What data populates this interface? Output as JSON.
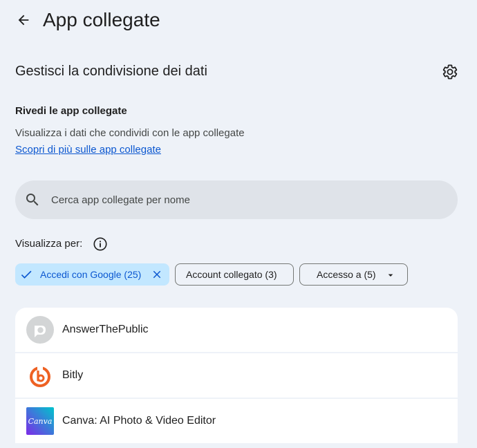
{
  "header": {
    "title": "App collegate"
  },
  "section": {
    "title": "Gestisci la condivisione dei dati"
  },
  "review": {
    "heading": "Rivedi le app collegate",
    "description": "Visualizza i dati che condividi con le app collegate",
    "learn_more": "Scopri di più sulle app collegate"
  },
  "search": {
    "placeholder": "Cerca app collegate per nome",
    "value": ""
  },
  "filters": {
    "label": "Visualizza per:",
    "chips": [
      {
        "label": "Accedi con Google (25)",
        "selected": true
      },
      {
        "label": "Account collegato (3)",
        "selected": false
      },
      {
        "label": "Accesso a (5)",
        "selected": false,
        "dropdown": true
      }
    ]
  },
  "apps": [
    {
      "name": "AnswerThePublic",
      "icon": "answerthepublic-logo"
    },
    {
      "name": "Bitly",
      "icon": "bitly-logo"
    },
    {
      "name": "Canva: AI Photo & Video Editor",
      "icon": "canva-logo",
      "logo_text": "Canva"
    }
  ],
  "colors": {
    "background": "#eef2f8",
    "accent": "#0b57d0",
    "chip_selected_bg": "#c2e7ff",
    "search_bg": "#dfe3e9",
    "bitly_orange": "#ee6123"
  }
}
